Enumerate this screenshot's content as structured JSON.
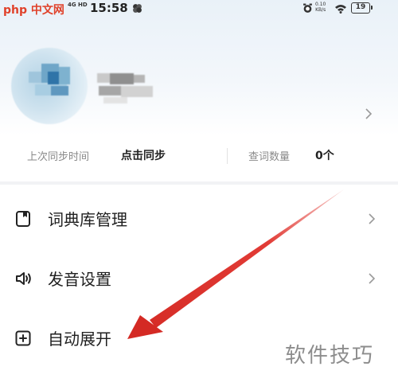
{
  "status_bar": {
    "watermark_logo": "php 中文网",
    "signal": "4G HD",
    "time": "15:58",
    "net_speed_value": "0.10",
    "net_speed_unit": "KB/s",
    "battery": "19"
  },
  "profile": {
    "avatar_icon": "avatar-blurred",
    "username_icon": "username-blurred"
  },
  "stats": {
    "last_sync_label": "上次同步时间",
    "last_sync_value": "点击同步",
    "word_count_label": "查词数量",
    "word_count_value": "0个"
  },
  "menu": [
    {
      "label": "词典库管理",
      "icon": "dictionary-icon",
      "has_chevron": true
    },
    {
      "label": "发音设置",
      "icon": "speaker-icon",
      "has_chevron": true
    },
    {
      "label": "自动展开",
      "icon": "expand-square-icon",
      "has_chevron": false
    }
  ],
  "watermark": "软件技巧",
  "colors": {
    "annotation": "#e0312b",
    "text_primary": "#1f1f1f",
    "text_secondary": "#8a8a8a",
    "header_bg": "#e9f1f8"
  }
}
